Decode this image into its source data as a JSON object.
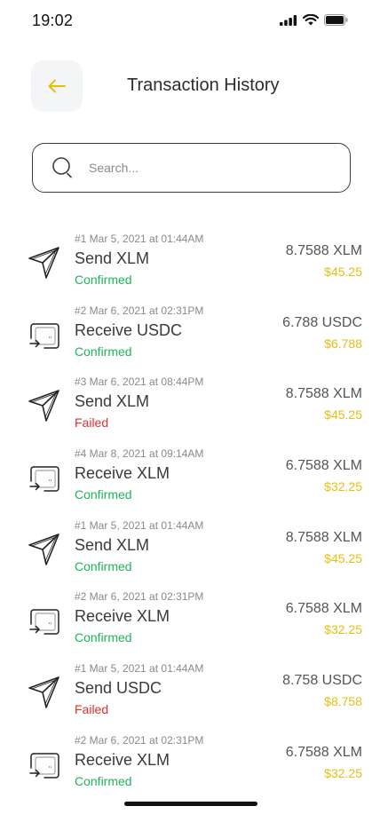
{
  "status_bar": {
    "time": "19:02"
  },
  "header": {
    "title": "Transaction History"
  },
  "search": {
    "placeholder": "Search..."
  },
  "colors": {
    "confirmed": "#1fb35a",
    "failed": "#e0312b",
    "fiat": "#e6be10",
    "accent": "#e6be10"
  },
  "transactions": [
    {
      "type": "send",
      "icon": "send-icon",
      "meta": "#1 Mar 5, 2021 at 01:44AM",
      "title": "Send XLM",
      "status": "Confirmed",
      "amount": "8.7588 XLM",
      "fiat": "$45.25"
    },
    {
      "type": "receive",
      "icon": "receive-icon",
      "meta": "#2 Mar 6, 2021 at 02:31PM",
      "title": "Receive USDC",
      "status": "Confirmed",
      "amount": "6.788 USDC",
      "fiat": "$6.788"
    },
    {
      "type": "send",
      "icon": "send-icon",
      "meta": "#3 Mar 6, 2021 at 08:44PM",
      "title": "Send XLM",
      "status": "Failed",
      "amount": "8.7588 XLM",
      "fiat": "$45.25"
    },
    {
      "type": "receive",
      "icon": "receive-icon",
      "meta": "#4 Mar 8, 2021 at 09:14AM",
      "title": "Receive XLM",
      "status": "Confirmed",
      "amount": "6.7588 XLM",
      "fiat": "$32.25"
    },
    {
      "type": "send",
      "icon": "send-icon",
      "meta": "#1 Mar 5, 2021 at 01:44AM",
      "title": "Send XLM",
      "status": "Confirmed",
      "amount": "8.7588 XLM",
      "fiat": "$45.25"
    },
    {
      "type": "receive",
      "icon": "receive-icon",
      "meta": "#2 Mar 6, 2021 at 02:31PM",
      "title": "Receive XLM",
      "status": "Confirmed",
      "amount": "6.7588 XLM",
      "fiat": "$32.25"
    },
    {
      "type": "send",
      "icon": "send-icon",
      "meta": "#1 Mar 5, 2021 at 01:44AM",
      "title": "Send USDC",
      "status": "Failed",
      "amount": "8.758 USDC",
      "fiat": "$8.758"
    },
    {
      "type": "receive",
      "icon": "receive-icon",
      "meta": "#2 Mar 6, 2021 at 02:31PM",
      "title": "Receive XLM",
      "status": "Confirmed",
      "amount": "6.7588 XLM",
      "fiat": "$32.25"
    }
  ]
}
